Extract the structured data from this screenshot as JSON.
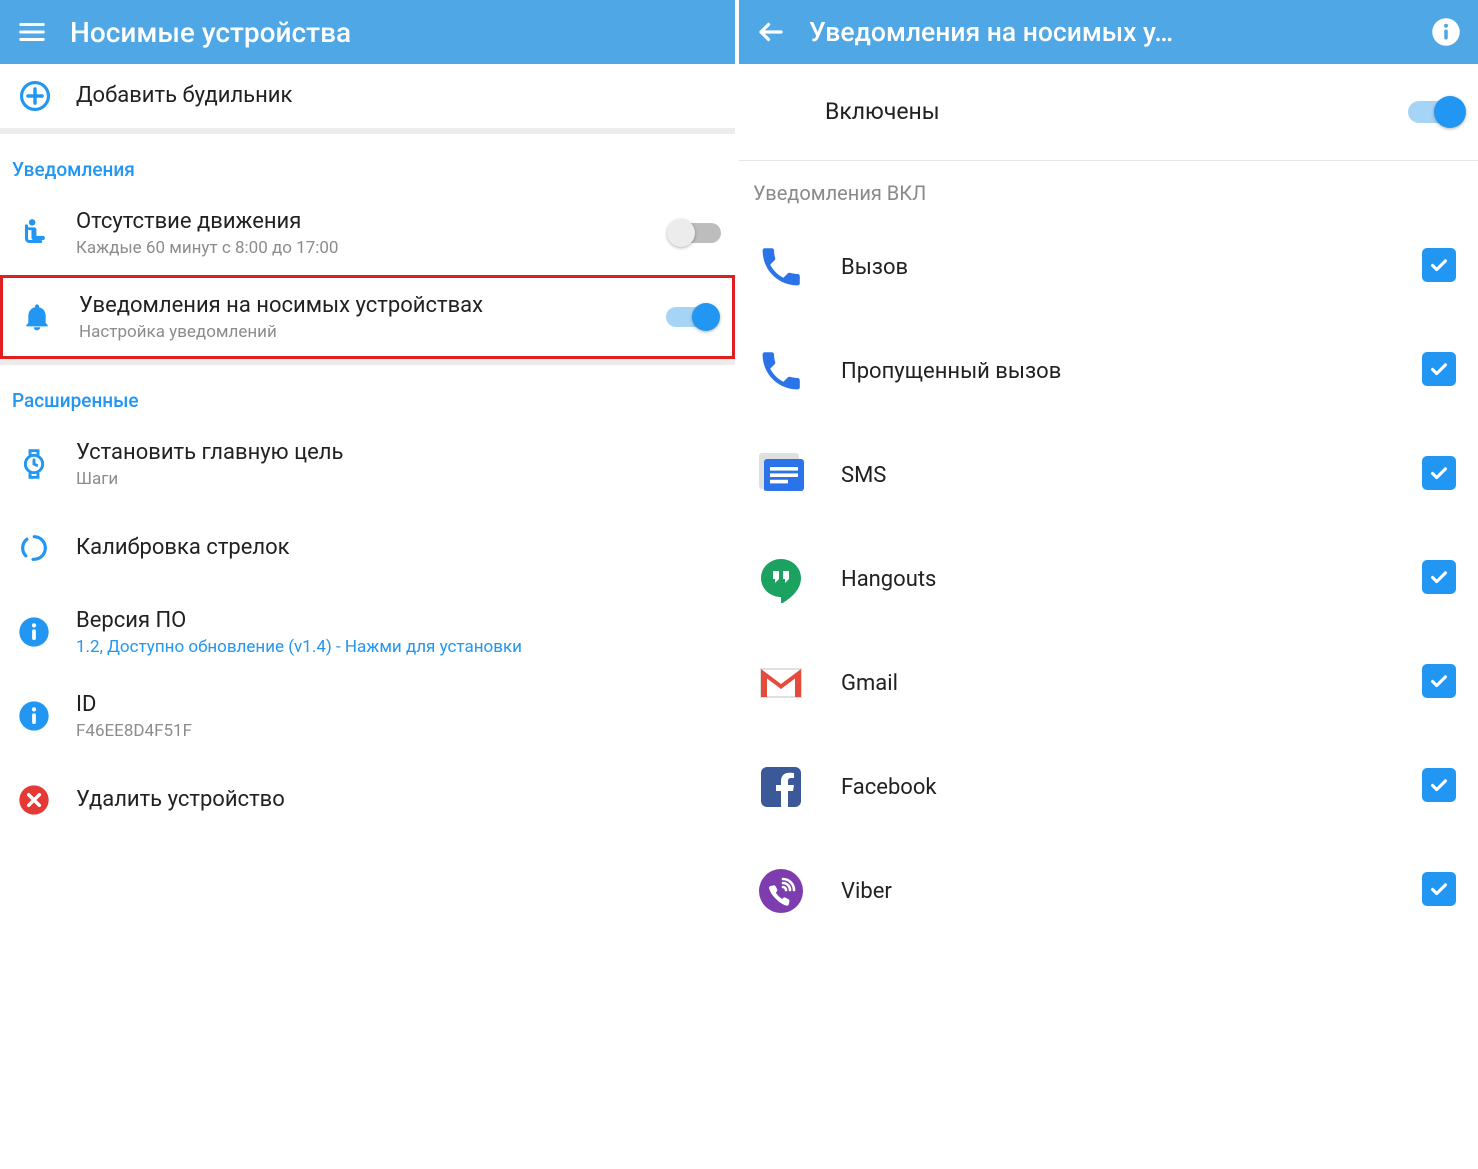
{
  "left": {
    "appbar": {
      "title": "Носимые устройства"
    },
    "add_alarm": {
      "label": "Добавить будильник"
    },
    "sections": {
      "notifications": {
        "header": "Уведомления",
        "inactivity": {
          "title": "Отсутствие движения",
          "sub": "Каждые 60 минут с 8:00 до 17:00",
          "on": false
        },
        "wearable_notifications": {
          "title": "Уведомления на носимых устройствах",
          "sub": "Настройка уведомлений",
          "on": true
        }
      },
      "advanced": {
        "header": "Расширенные",
        "main_goal": {
          "title": "Установить главную цель",
          "sub": "Шаги"
        },
        "calibrate": {
          "title": "Калибровка стрелок"
        },
        "firmware": {
          "title": "Версия ПО",
          "sub": "1.2, Доступно обновление (v1.4) - Нажми для установки"
        },
        "id": {
          "title": "ID",
          "sub": "F46EE8D4F51F"
        },
        "remove": {
          "title": "Удалить устройство"
        }
      }
    }
  },
  "right": {
    "appbar": {
      "title": "Уведомления на носимых у…"
    },
    "enabled": {
      "label": "Включены",
      "on": true
    },
    "list_header": "Уведомления ВКЛ",
    "apps": [
      {
        "name": "Вызов",
        "icon": "phone",
        "checked": true
      },
      {
        "name": "Пропущенный вызов",
        "icon": "phone",
        "checked": true
      },
      {
        "name": "SMS",
        "icon": "sms",
        "checked": true
      },
      {
        "name": "Hangouts",
        "icon": "hangouts",
        "checked": true
      },
      {
        "name": "Gmail",
        "icon": "gmail",
        "checked": true
      },
      {
        "name": "Facebook",
        "icon": "facebook",
        "checked": true
      },
      {
        "name": "Viber",
        "icon": "viber",
        "checked": true
      }
    ]
  }
}
